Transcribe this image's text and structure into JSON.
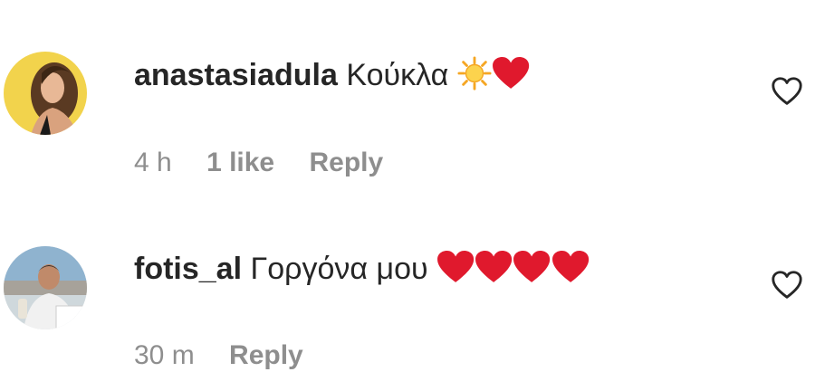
{
  "comments": [
    {
      "username": "anastasiadula",
      "text": "Κούκλα",
      "emojis": [
        "sun-emoji",
        "red-heart-emoji"
      ],
      "time": "4 h",
      "likes": "1 like",
      "reply": "Reply",
      "like_icon": "heart-outline-icon"
    },
    {
      "username": "fotis_al",
      "text": "Γοργόνα μου",
      "emojis": [
        "red-heart-emoji",
        "red-heart-emoji",
        "red-heart-emoji",
        "red-heart-emoji"
      ],
      "time": "30 m",
      "reply": "Reply",
      "like_icon": "heart-outline-icon"
    }
  ],
  "colors": {
    "text": "#262626",
    "secondary": "#8e8e8e",
    "heart_red": "#e0192d",
    "avatar1_bg": "#f2d34c"
  }
}
